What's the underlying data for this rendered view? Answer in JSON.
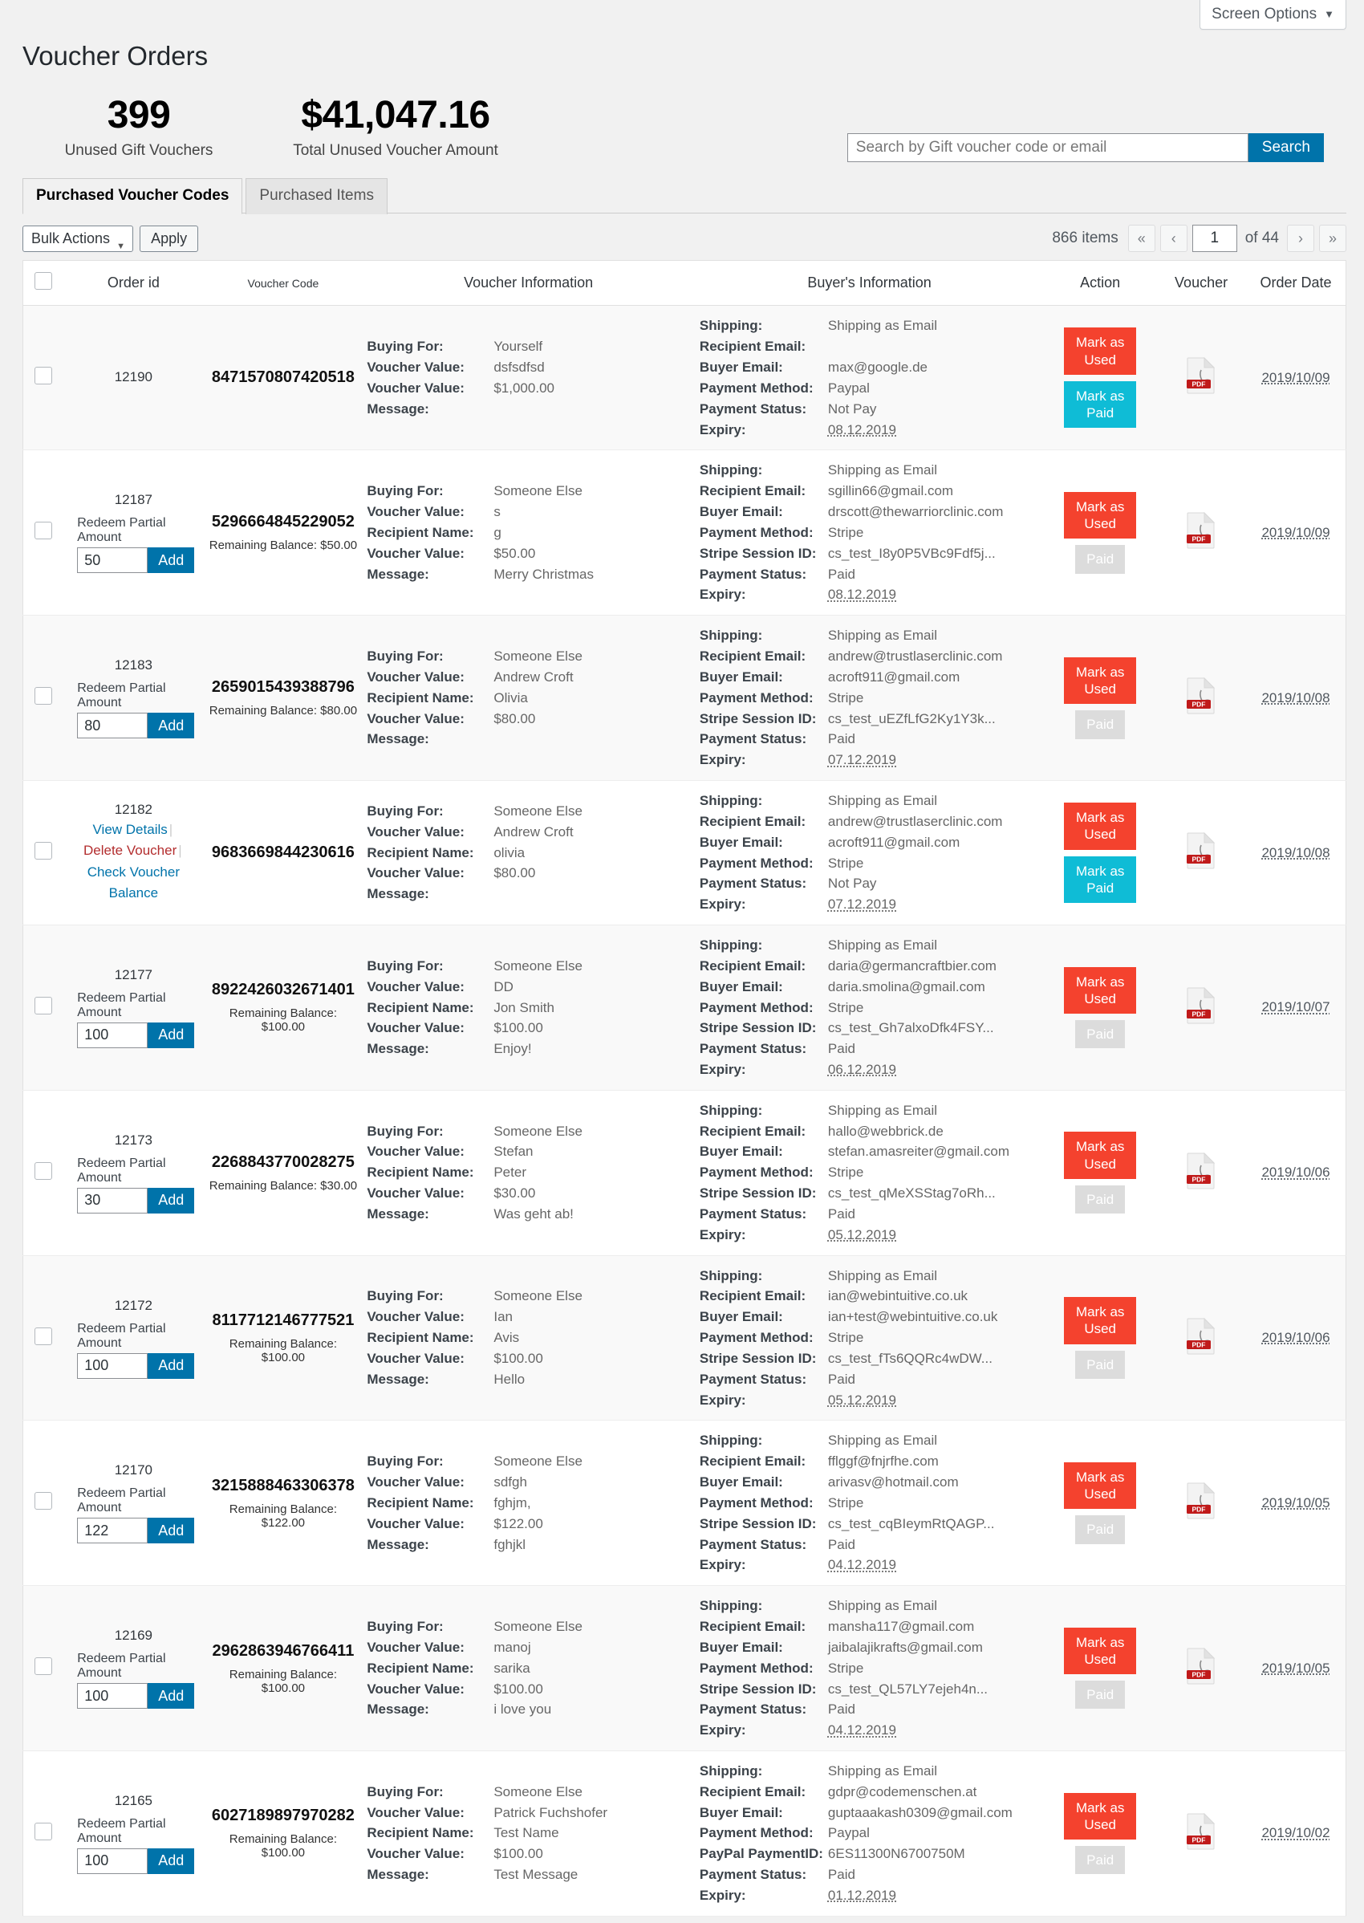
{
  "screen_options": {
    "label": "Screen Options",
    "caret": "▼"
  },
  "header": {
    "title": "Voucher Orders",
    "stats": [
      {
        "value": "399",
        "label": "Unused Gift Vouchers"
      },
      {
        "value": "$41,047.16",
        "label": "Total Unused Voucher Amount"
      }
    ],
    "search": {
      "placeholder": "Search by Gift voucher code or email",
      "value": "",
      "button": "Search"
    }
  },
  "tabs": [
    {
      "label": "Purchased Voucher Codes",
      "active": true
    },
    {
      "label": "Purchased Items",
      "active": false
    }
  ],
  "tablenav": {
    "bulk_actions_label": "Bulk Actions",
    "bulk_caret": "▼",
    "apply_label": "Apply",
    "items_count": "866 items",
    "first_label": "«",
    "prev_label": "‹",
    "current_page": "1",
    "of_label": "of 44",
    "next_label": "›",
    "last_label": "»"
  },
  "table": {
    "headers": {
      "order_id": "Order id",
      "voucher_code": "Voucher Code",
      "voucher_information": "Voucher Information",
      "buyers_information": "Buyer's Information",
      "action": "Action",
      "voucher": "Voucher",
      "order_date": "Order Date"
    },
    "labels": {
      "buying_for": "Buying For:",
      "voucher_value": "Voucher Value:",
      "recipient_name": "Recipient Name:",
      "message": "Message:",
      "shipping": "Shipping:",
      "recipient_email": "Recipient Email:",
      "buyer_email": "Buyer Email:",
      "payment_method": "Payment Method:",
      "stripe_session_id": "Stripe Session ID:",
      "paypal_payment_id": "PayPal PaymentID:",
      "payment_status": "Payment Status:",
      "expiry": "Expiry:",
      "redeem_partial": "Redeem Partial Amount",
      "add": "Add",
      "mark_as_used": "Mark as Used",
      "mark_as_paid": "Mark as Paid",
      "paid_disabled": "Paid",
      "view_details": "View Details",
      "delete_voucher": "Delete Voucher",
      "check_voucher_balance": "Check Voucher Balance",
      "remaining_balance_prefix": "Remaining Balance: "
    },
    "rows": [
      {
        "order_id": "12190",
        "has_row_actions": false,
        "has_redeem": false,
        "redeem_value": "",
        "voucher_code": "8471570807420518",
        "remaining_balance": "",
        "buying_for": "Yourself",
        "voucher_value_1": "dsfsdfsd",
        "recipient_name": "",
        "has_recipient_name": false,
        "voucher_value_2": "$1,000.00",
        "message": "",
        "shipping": "Shipping as Email",
        "recipient_email": "",
        "buyer_email": "max@google.de",
        "payment_method": "Paypal",
        "payment_ref_label": "",
        "payment_ref": "",
        "payment_status": "Not Pay",
        "expiry": "08.12.2019",
        "action_paid_enabled": true,
        "order_date": "2019/10/09"
      },
      {
        "order_id": "12187",
        "has_row_actions": false,
        "has_redeem": true,
        "redeem_value": "50",
        "voucher_code": "5296664845229052",
        "remaining_balance": "$50.00",
        "buying_for": "Someone Else",
        "voucher_value_1": "s",
        "recipient_name": "g",
        "has_recipient_name": true,
        "voucher_value_2": "$50.00",
        "message": "Merry Christmas",
        "shipping": "Shipping as Email",
        "recipient_email": "sgillin66@gmail.com",
        "buyer_email": "drscott@thewarriorclinic.com",
        "payment_method": "Stripe",
        "payment_ref_label": "Stripe Session ID:",
        "payment_ref": "cs_test_I8y0P5VBc9Fdf5j...",
        "payment_status": "Paid",
        "expiry": "08.12.2019",
        "action_paid_enabled": false,
        "order_date": "2019/10/09"
      },
      {
        "order_id": "12183",
        "has_row_actions": false,
        "has_redeem": true,
        "redeem_value": "80",
        "voucher_code": "2659015439388796",
        "remaining_balance": "$80.00",
        "buying_for": "Someone Else",
        "voucher_value_1": "Andrew Croft",
        "recipient_name": "Olivia",
        "has_recipient_name": true,
        "voucher_value_2": "$80.00",
        "message": "",
        "shipping": "Shipping as Email",
        "recipient_email": "andrew@trustlaserclinic.com",
        "buyer_email": "acroft911@gmail.com",
        "payment_method": "Stripe",
        "payment_ref_label": "Stripe Session ID:",
        "payment_ref": "cs_test_uEZfLfG2Ky1Y3k...",
        "payment_status": "Paid",
        "expiry": "07.12.2019",
        "action_paid_enabled": false,
        "order_date": "2019/10/08"
      },
      {
        "order_id": "12182",
        "has_row_actions": true,
        "has_redeem": false,
        "redeem_value": "",
        "voucher_code": "9683669844230616",
        "remaining_balance": "",
        "buying_for": "Someone Else",
        "voucher_value_1": "Andrew Croft",
        "recipient_name": "olivia",
        "has_recipient_name": true,
        "voucher_value_2": "$80.00",
        "message": "",
        "shipping": "Shipping as Email",
        "recipient_email": "andrew@trustlaserclinic.com",
        "buyer_email": "acroft911@gmail.com",
        "payment_method": "Stripe",
        "payment_ref_label": "",
        "payment_ref": "",
        "payment_status": "Not Pay",
        "expiry": "07.12.2019",
        "action_paid_enabled": true,
        "order_date": "2019/10/08"
      },
      {
        "order_id": "12177",
        "has_row_actions": false,
        "has_redeem": true,
        "redeem_value": "100",
        "voucher_code": "8922426032671401",
        "remaining_balance": "$100.00",
        "buying_for": "Someone Else",
        "voucher_value_1": "DD",
        "recipient_name": "Jon Smith",
        "has_recipient_name": true,
        "voucher_value_2": "$100.00",
        "message": "Enjoy!",
        "shipping": "Shipping as Email",
        "recipient_email": "daria@germancraftbier.com",
        "buyer_email": "daria.smolina@gmail.com",
        "payment_method": "Stripe",
        "payment_ref_label": "Stripe Session ID:",
        "payment_ref": "cs_test_Gh7alxoDfk4FSY...",
        "payment_status": "Paid",
        "expiry": "06.12.2019",
        "action_paid_enabled": false,
        "order_date": "2019/10/07"
      },
      {
        "order_id": "12173",
        "has_row_actions": false,
        "has_redeem": true,
        "redeem_value": "30",
        "voucher_code": "2268843770028275",
        "remaining_balance": "$30.00",
        "buying_for": "Someone Else",
        "voucher_value_1": "Stefan",
        "recipient_name": "Peter",
        "has_recipient_name": true,
        "voucher_value_2": "$30.00",
        "message": "Was geht ab!",
        "shipping": "Shipping as Email",
        "recipient_email": "hallo@webbrick.de",
        "buyer_email": "stefan.amasreiter@gmail.com",
        "payment_method": "Stripe",
        "payment_ref_label": "Stripe Session ID:",
        "payment_ref": "cs_test_qMeXSStag7oRh...",
        "payment_status": "Paid",
        "expiry": "05.12.2019",
        "action_paid_enabled": false,
        "order_date": "2019/10/06"
      },
      {
        "order_id": "12172",
        "has_row_actions": false,
        "has_redeem": true,
        "redeem_value": "100",
        "voucher_code": "8117712146777521",
        "remaining_balance": "$100.00",
        "buying_for": "Someone Else",
        "voucher_value_1": "Ian",
        "recipient_name": "Avis",
        "has_recipient_name": true,
        "voucher_value_2": "$100.00",
        "message": "Hello",
        "shipping": "Shipping as Email",
        "recipient_email": "ian@webintuitive.co.uk",
        "buyer_email": "ian+test@webintuitive.co.uk",
        "payment_method": "Stripe",
        "payment_ref_label": "Stripe Session ID:",
        "payment_ref": "cs_test_fTs6QQRc4wDW...",
        "payment_status": "Paid",
        "expiry": "05.12.2019",
        "action_paid_enabled": false,
        "order_date": "2019/10/06"
      },
      {
        "order_id": "12170",
        "has_row_actions": false,
        "has_redeem": true,
        "redeem_value": "122",
        "voucher_code": "3215888463306378",
        "remaining_balance": "$122.00",
        "buying_for": "Someone Else",
        "voucher_value_1": "sdfgh",
        "recipient_name": "fghjm,",
        "has_recipient_name": true,
        "voucher_value_2": "$122.00",
        "message": "fghjkl",
        "shipping": "Shipping as Email",
        "recipient_email": "fflggf@fnjrfhe.com",
        "buyer_email": "arivasv@hotmail.com",
        "payment_method": "Stripe",
        "payment_ref_label": "Stripe Session ID:",
        "payment_ref": "cs_test_cqBIeymRtQAGP...",
        "payment_status": "Paid",
        "expiry": "04.12.2019",
        "action_paid_enabled": false,
        "order_date": "2019/10/05"
      },
      {
        "order_id": "12169",
        "has_row_actions": false,
        "has_redeem": true,
        "redeem_value": "100",
        "voucher_code": "2962863946766411",
        "remaining_balance": "$100.00",
        "buying_for": "Someone Else",
        "voucher_value_1": "manoj",
        "recipient_name": "sarika",
        "has_recipient_name": true,
        "voucher_value_2": "$100.00",
        "message": "i love you",
        "shipping": "Shipping as Email",
        "recipient_email": "mansha117@gmail.com",
        "buyer_email": "jaibalajikrafts@gmail.com",
        "payment_method": "Stripe",
        "payment_ref_label": "Stripe Session ID:",
        "payment_ref": "cs_test_QL57LY7ejeh4n...",
        "payment_status": "Paid",
        "expiry": "04.12.2019",
        "action_paid_enabled": false,
        "order_date": "2019/10/05"
      },
      {
        "order_id": "12165",
        "has_row_actions": false,
        "has_redeem": true,
        "redeem_value": "100",
        "voucher_code": "6027189897970282",
        "remaining_balance": "$100.00",
        "buying_for": "Someone Else",
        "voucher_value_1": "Patrick Fuchshofer",
        "recipient_name": "Test Name",
        "has_recipient_name": true,
        "voucher_value_2": "$100.00",
        "message": "Test Message",
        "shipping": "Shipping as Email",
        "recipient_email": "gdpr@codemenschen.at",
        "buyer_email": "guptaaakash0309@gmail.com",
        "payment_method": "Paypal",
        "payment_ref_label": "PayPal PaymentID:",
        "payment_ref": "6ES11300N6700750M",
        "payment_status": "Paid",
        "expiry": "01.12.2019",
        "action_paid_enabled": false,
        "order_date": "2019/10/02"
      }
    ]
  },
  "colors": {
    "accent_blue": "#0073aa",
    "mark_used_red": "#f4422e",
    "mark_paid_cyan": "#0fbcd6",
    "pdf_red": "#c01a1a",
    "link_blue": "#0073aa",
    "delete_red": "#b32d2e"
  }
}
